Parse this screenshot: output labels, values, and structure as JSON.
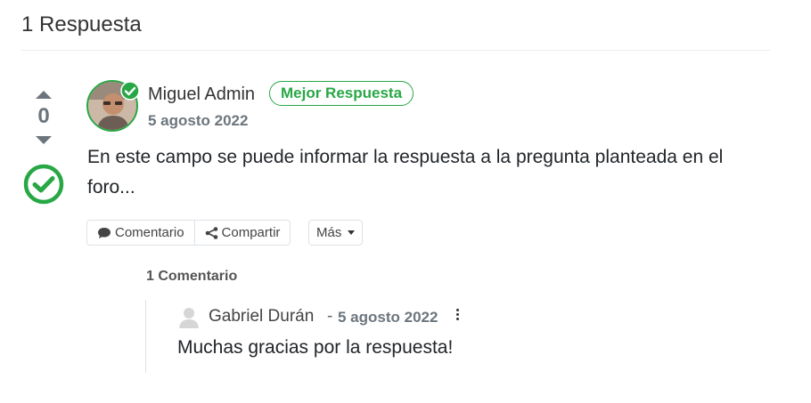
{
  "answers": {
    "header": "1 Respuesta"
  },
  "answer": {
    "votes": "0",
    "author": "Miguel Admin",
    "badge": "Mejor Respuesta",
    "date": "5 agosto 2022",
    "body": "En este campo se puede informar la respuesta a la pregunta planteada en el foro...",
    "actions": {
      "comment_label": "Comentario",
      "share_label": "Compartir",
      "more_label": "Más"
    }
  },
  "comments": {
    "count_label": "1 Comentario",
    "items": [
      {
        "author": "Gabriel Durán",
        "separator": "-",
        "date": "5 agosto 2022",
        "text": "Muchas gracias por la respuesta!"
      }
    ]
  },
  "colors": {
    "accent_green": "#28a745",
    "muted_gray": "#6c757d"
  },
  "icons": {
    "vote_up": "caret-up-icon",
    "vote_down": "caret-down-icon",
    "accepted": "check-circle-icon",
    "verified": "verified-check-icon",
    "comment": "speech-bubble-icon",
    "share": "share-nodes-icon",
    "more": "kebab-menu-icon",
    "user": "user-placeholder-icon"
  }
}
